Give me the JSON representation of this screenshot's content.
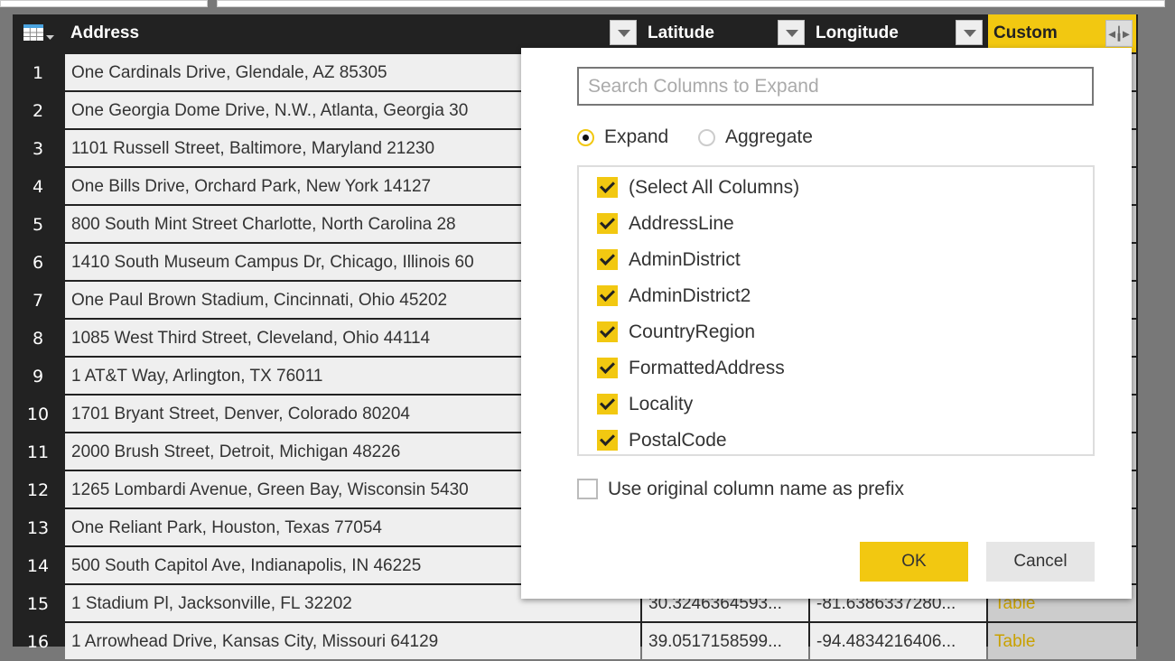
{
  "columns": {
    "address": "Address",
    "latitude": "Latitude",
    "longitude": "Longitude",
    "custom": "Custom"
  },
  "rows": [
    {
      "n": "1",
      "address": "One Cardinals Drive, Glendale, AZ 85305"
    },
    {
      "n": "2",
      "address": "One Georgia Dome Drive, N.W., Atlanta, Georgia 30"
    },
    {
      "n": "3",
      "address": "1101 Russell Street, Baltimore, Maryland 21230"
    },
    {
      "n": "4",
      "address": "One Bills Drive, Orchard Park, New York 14127"
    },
    {
      "n": "5",
      "address": "800 South Mint Street Charlotte, North Carolina 28"
    },
    {
      "n": "6",
      "address": "1410 South Museum Campus Dr, Chicago, Illinois 60"
    },
    {
      "n": "7",
      "address": "One Paul Brown Stadium, Cincinnati, Ohio 45202"
    },
    {
      "n": "8",
      "address": "1085 West Third Street, Cleveland, Ohio 44114"
    },
    {
      "n": "9",
      "address": "1 AT&T Way, Arlington, TX 76011"
    },
    {
      "n": "10",
      "address": "1701 Bryant Street, Denver, Colorado 80204"
    },
    {
      "n": "11",
      "address": "2000 Brush Street, Detroit, Michigan 48226"
    },
    {
      "n": "12",
      "address": "1265 Lombardi Avenue, Green Bay, Wisconsin 5430"
    },
    {
      "n": "13",
      "address": "One Reliant Park, Houston, Texas 77054"
    },
    {
      "n": "14",
      "address": "500 South Capitol Ave, Indianapolis, IN 46225"
    },
    {
      "n": "15",
      "address": "1 Stadium Pl, Jacksonville, FL 32202",
      "lat": "30.3246364593...",
      "lon": "-81.6386337280...",
      "custom": "Table"
    },
    {
      "n": "16",
      "address": "1 Arrowhead Drive, Kansas City, Missouri 64129",
      "lat": "39.0517158599...",
      "lon": "-94.4834216406...",
      "custom": "Table"
    }
  ],
  "dialog": {
    "search_placeholder": "Search Columns to Expand",
    "expand_label": "Expand",
    "aggregate_label": "Aggregate",
    "columns": [
      "(Select All Columns)",
      "AddressLine",
      "AdminDistrict",
      "AdminDistrict2",
      "CountryRegion",
      "FormattedAddress",
      "Locality",
      "PostalCode"
    ],
    "prefix_label": "Use original column name as prefix",
    "ok": "OK",
    "cancel": "Cancel"
  },
  "colors": {
    "accent": "#f2c811"
  }
}
